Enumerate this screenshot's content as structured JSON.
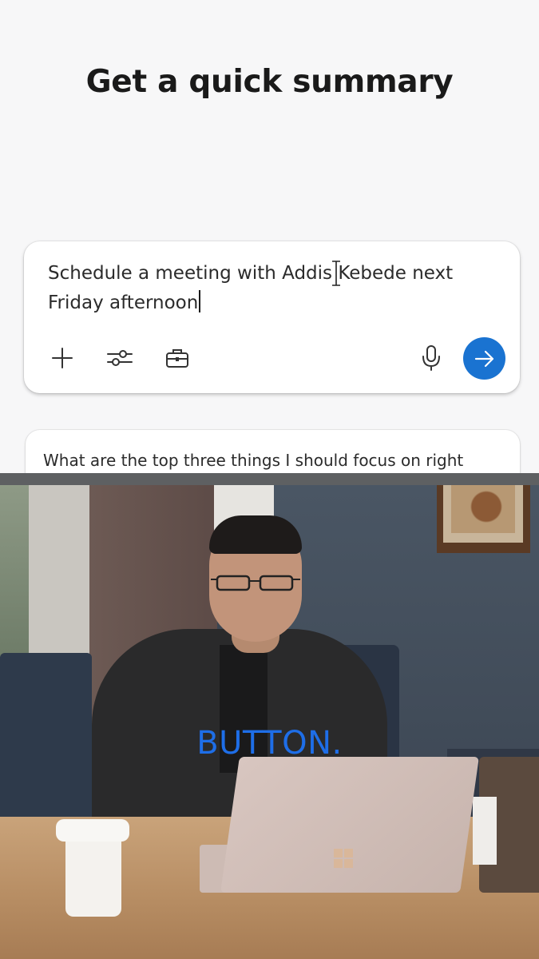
{
  "headline": "Get a quick summary",
  "composer": {
    "prompt_text": "Schedule a meeting with Addis Kebede next Friday afternoon",
    "buttons": {
      "add": "plus-icon",
      "settings": "sliders-icon",
      "tools": "briefcase-icon",
      "voice": "microphone-icon",
      "send": "arrow-right-icon"
    },
    "send_color": "#1a73d1"
  },
  "suggestion": {
    "text": "What are the top three things I should focus on right"
  },
  "video": {
    "caption": "BUTTON.",
    "caption_color": "#1e6ee8"
  }
}
